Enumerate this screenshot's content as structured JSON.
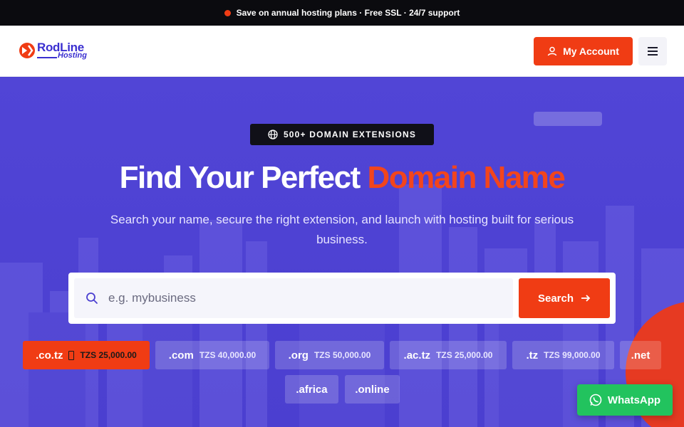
{
  "topbar": {
    "text": "Save on annual hosting plans · Free SSL · 24/7 support"
  },
  "logo": {
    "name": "RodLine",
    "tagline": "Hosting"
  },
  "header": {
    "account_label": "My Account"
  },
  "hero": {
    "badge": "500+ DOMAIN EXTENSIONS",
    "headline_main": "Find Your Perfect",
    "headline_accent": "Domain Name",
    "subtext": "Search your name, secure the right extension, and launch with hosting built for serious business."
  },
  "search": {
    "placeholder": "e.g. mybusiness",
    "value": "",
    "button_label": "Search"
  },
  "tlds": [
    {
      "ext": ".co.tz",
      "price": "TZS 25,000.00",
      "selected": true
    },
    {
      "ext": ".com",
      "price": "TZS 40,000.00",
      "selected": false
    },
    {
      "ext": ".org",
      "price": "TZS 50,000.00",
      "selected": false
    },
    {
      "ext": ".ac.tz",
      "price": "TZS 25,000.00",
      "selected": false
    },
    {
      "ext": ".tz",
      "price": "TZS 99,000.00",
      "selected": false
    },
    {
      "ext": ".net",
      "price": "",
      "selected": false
    },
    {
      "ext": ".africa",
      "price": "",
      "selected": false
    },
    {
      "ext": ".online",
      "price": "",
      "selected": false
    }
  ],
  "whatsapp": {
    "label": "WhatsApp"
  },
  "colors": {
    "accent": "#f03c14",
    "brand": "#3a2fd0",
    "hero_bg": "#4e42d3",
    "whatsapp": "#22c35e",
    "topbar": "#0b0b0f"
  },
  "icons": [
    "alert-dot-icon",
    "user-icon",
    "menu-icon",
    "globe-icon",
    "search-icon",
    "arrow-right-icon",
    "tag-icon",
    "whatsapp-icon"
  ]
}
